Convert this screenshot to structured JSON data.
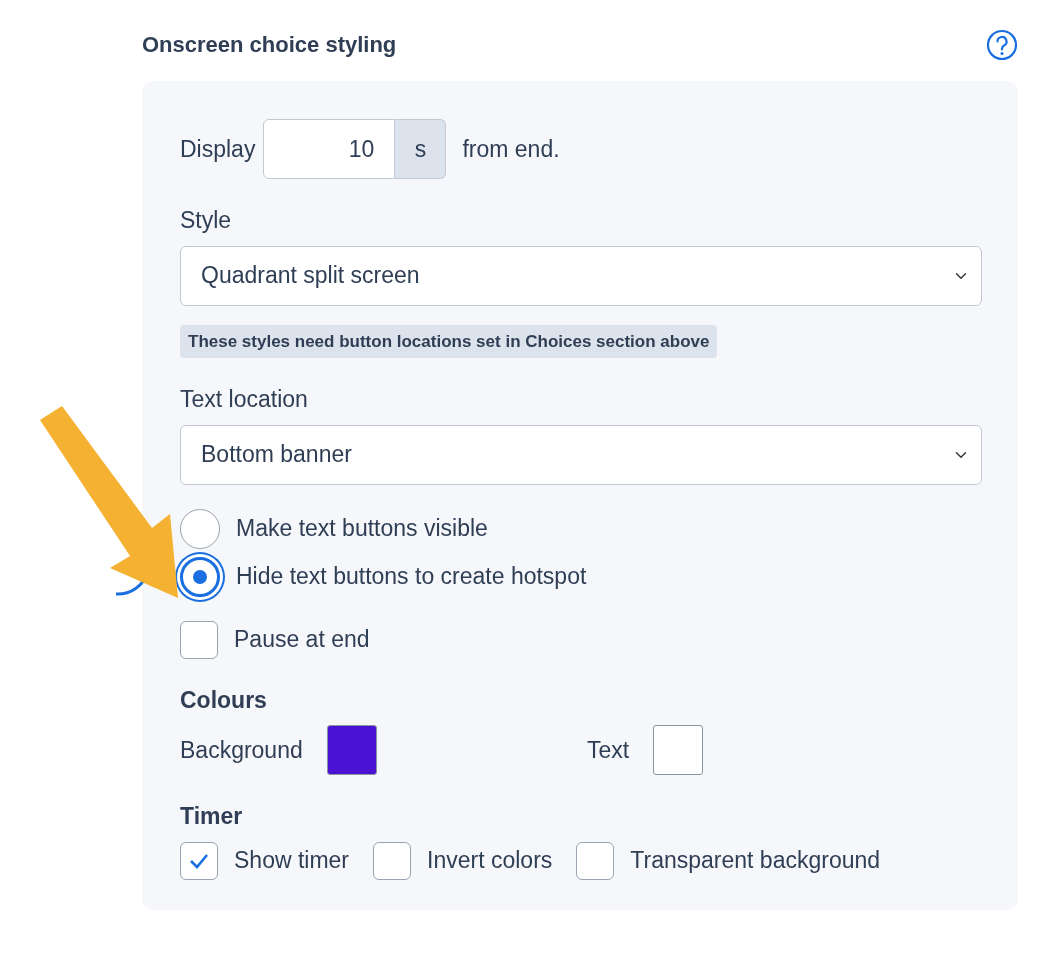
{
  "header": {
    "title": "Onscreen choice styling"
  },
  "display": {
    "label": "Display",
    "value": "10",
    "unit": "s",
    "suffix": "from end."
  },
  "style": {
    "label": "Style",
    "value": "Quadrant split screen",
    "hint": "These styles need button locations set in Choices section above"
  },
  "text_location": {
    "label": "Text location",
    "value": "Bottom banner"
  },
  "button_visibility": [
    {
      "label": "Make text buttons visible",
      "selected": false
    },
    {
      "label": "Hide text buttons to create hotspot",
      "selected": true
    }
  ],
  "pause_at_end": {
    "label": "Pause at end",
    "checked": false
  },
  "colours": {
    "title": "Colours",
    "items": [
      {
        "label": "Background",
        "color": "#4b12d4"
      },
      {
        "label": "Text",
        "color": "#ffffff"
      }
    ]
  },
  "timer": {
    "title": "Timer",
    "options": [
      {
        "label": "Show timer",
        "checked": true
      },
      {
        "label": "Invert colors",
        "checked": false
      },
      {
        "label": "Transparent background",
        "checked": false
      }
    ]
  }
}
